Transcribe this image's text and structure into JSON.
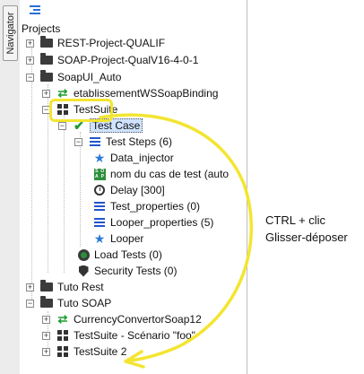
{
  "navigator": {
    "tab_label": "Navigator"
  },
  "panel": {
    "toolbar_icon": "list-view-icon",
    "projects_label": "Projects"
  },
  "tree": [
    {
      "label": "REST-Project-QUALIF",
      "icon": "folder-icon",
      "toggle": "+"
    },
    {
      "label": "SOAP-Project-QualV16-4-0-1",
      "icon": "folder-icon",
      "toggle": "+"
    },
    {
      "label": "SoapUI_Auto",
      "icon": "folder-icon",
      "toggle": "−"
    },
    {
      "label": "etablissementWSSoapBinding",
      "icon": "interface-icon",
      "toggle": "+"
    },
    {
      "label": "TestSuite",
      "icon": "testsuite-icon",
      "toggle": "−"
    },
    {
      "label": "Test Case",
      "icon": "testcase-check-icon",
      "toggle": "−"
    },
    {
      "label": "Test Steps (6)",
      "icon": "test-steps-icon",
      "toggle": "−"
    },
    {
      "label": "Data_injector",
      "icon": "star-icon"
    },
    {
      "label": "nom du cas de test (auto",
      "icon": "soap-request-icon"
    },
    {
      "label": "Delay [300]",
      "icon": "clock-icon"
    },
    {
      "label": "Test_properties (0)",
      "icon": "properties-icon"
    },
    {
      "label": "Looper_properties (5)",
      "icon": "properties-icon"
    },
    {
      "label": "Looper",
      "icon": "star-icon"
    },
    {
      "label": "Load Tests (0)",
      "icon": "load-test-icon"
    },
    {
      "label": "Security Tests (0)",
      "icon": "shield-icon"
    },
    {
      "label": "Tuto Rest",
      "icon": "folder-icon",
      "toggle": "+"
    },
    {
      "label": "Tuto SOAP",
      "icon": "folder-icon",
      "toggle": "−"
    },
    {
      "label": "CurrencyConvertorSoap12",
      "icon": "interface-icon",
      "toggle": "+"
    },
    {
      "label": "TestSuite - Scénario \"foo\"",
      "icon": "testsuite-icon",
      "toggle": "+"
    },
    {
      "label": "TestSuite 2",
      "icon": "testsuite-icon",
      "toggle": "+"
    }
  ],
  "annotation": {
    "line1": "CTRL + clic",
    "line2": "Glisser-déposer",
    "color": "#f3e531"
  }
}
